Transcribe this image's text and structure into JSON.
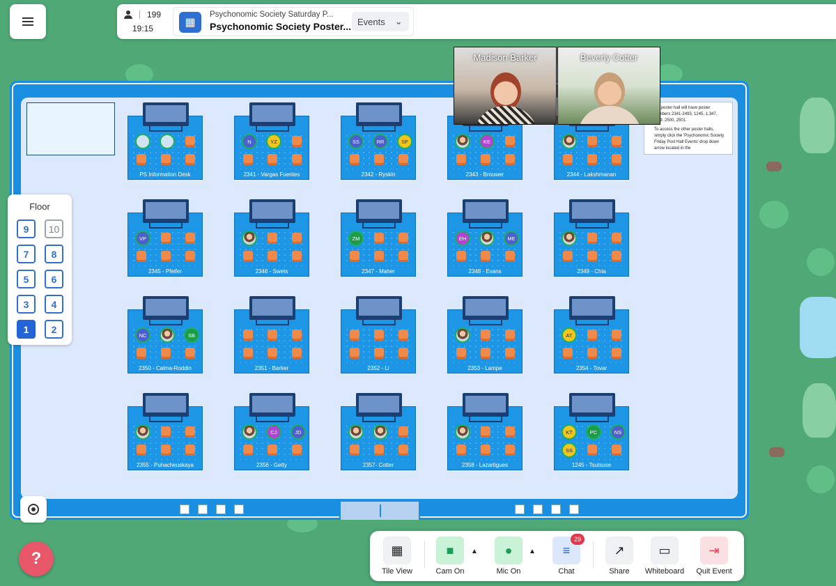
{
  "header": {
    "participants": "199",
    "time": "19:15",
    "event_subtitle": "Psychonomic Society Saturday P...",
    "event_title": "Psychonomic Society Poster...",
    "events_dropdown": "Events"
  },
  "floor_panel": {
    "title": "Floor",
    "floors": [
      "9",
      "10",
      "7",
      "8",
      "5",
      "6",
      "3",
      "4",
      "1",
      "2"
    ],
    "active": "1"
  },
  "videos": [
    {
      "name": "Madison Barker"
    },
    {
      "name": "Beverly Cotter"
    }
  ],
  "notes": {
    "line1": "...s poster hall will have poster numbers 2341-2493, 1245, 1,347, ...99, 2500, 2501.",
    "line2": "To access the other poster halls, simply click the 'Psychonomic Society Friday Post Hall Events' drop down arrow located in the"
  },
  "booths": [
    {
      "label": "PS Information Desk",
      "avatars": [
        {
          "t": "",
          "c": "#cfe3f2"
        },
        {
          "t": "",
          "c": "#cfe3f2"
        }
      ]
    },
    {
      "label": "2341 - Vargas Fuentes",
      "avatars": [
        {
          "t": "N",
          "c": "#4a5fd0"
        },
        {
          "t": "YZ",
          "c": "#f2c61f"
        }
      ]
    },
    {
      "label": "2342 - Ryskin",
      "avatars": [
        {
          "t": "SS",
          "c": "#4a5fd0"
        },
        {
          "t": "RR",
          "c": "#4a5fd0"
        },
        {
          "t": "SF",
          "c": "#f2c61f"
        }
      ]
    },
    {
      "label": "2343 - Brouwer",
      "avatars": [
        {
          "t": "",
          "c": "photo"
        },
        {
          "t": "KE",
          "c": "#b044d6"
        }
      ]
    },
    {
      "label": "2344 - Lakshmanan",
      "avatars": [
        {
          "t": "",
          "c": "photo"
        }
      ]
    },
    {
      "label": "2345 - Pfeifer",
      "avatars": [
        {
          "t": "VP",
          "c": "#4a5fd0"
        }
      ]
    },
    {
      "label": "2346 - Swets",
      "avatars": [
        {
          "t": "",
          "c": "photo"
        }
      ]
    },
    {
      "label": "2347 - Maher",
      "avatars": [
        {
          "t": "ZM",
          "c": "#1e9b4a"
        }
      ]
    },
    {
      "label": "2348 - Evans",
      "avatars": [
        {
          "t": "EH",
          "c": "#b044d6"
        },
        {
          "t": "",
          "c": "photo"
        },
        {
          "t": "ME",
          "c": "#4a5fd0"
        }
      ]
    },
    {
      "label": "2349 - Chia",
      "avatars": [
        {
          "t": "",
          "c": "photo"
        }
      ]
    },
    {
      "label": "2350 - Calma-Roddin",
      "avatars": [
        {
          "t": "NC",
          "c": "#4a5fd0"
        },
        {
          "t": "",
          "c": "photo"
        },
        {
          "t": "SB",
          "c": "#1e9b4a"
        }
      ]
    },
    {
      "label": "2351 - Barker",
      "avatars": []
    },
    {
      "label": "2352 - Li",
      "avatars": []
    },
    {
      "label": "2353 - Lampe",
      "avatars": [
        {
          "t": "",
          "c": "photo"
        }
      ]
    },
    {
      "label": "2354 - Tovar",
      "avatars": [
        {
          "t": "AT",
          "c": "#f2c61f"
        }
      ]
    },
    {
      "label": "2355 - Puhacheuskaya",
      "avatars": [
        {
          "t": "",
          "c": "photo"
        }
      ]
    },
    {
      "label": "2356 - Getty",
      "avatars": [
        {
          "t": "",
          "c": "photo"
        },
        {
          "t": "CJ",
          "c": "#b044d6"
        },
        {
          "t": "JD",
          "c": "#4a5fd0"
        }
      ]
    },
    {
      "label": "2357- Cotter",
      "avatars": [
        {
          "t": "",
          "c": "photo"
        },
        {
          "t": "",
          "c": "photo"
        }
      ]
    },
    {
      "label": "2358 - Lazartigues",
      "avatars": [
        {
          "t": "",
          "c": "photo"
        }
      ]
    },
    {
      "label": "1245 - Tsutsuse",
      "avatars": [
        {
          "t": "KT",
          "c": "#f2c61f"
        },
        {
          "t": "PC",
          "c": "#1e9b4a"
        },
        {
          "t": "NS",
          "c": "#4a5fd0"
        },
        {
          "t": "SS",
          "c": "#f2c61f"
        }
      ]
    }
  ],
  "toolbar": {
    "tile_view": "Tile View",
    "cam_on": "Cam On",
    "mic_on": "Mic On",
    "chat": "Chat",
    "chat_badge": "29",
    "share": "Share",
    "whiteboard": "Whiteboard",
    "quit_event": "Quit Event"
  },
  "icons": {
    "menu": "hamburger-icon",
    "participants": "person-icon",
    "event": "building-icon",
    "locate": "locate-icon",
    "help": "help-chat-icon"
  },
  "colors": {
    "grass": "#4fa876",
    "room_frame": "#1a8ee0",
    "floor": "#dce8fb",
    "accent": "#2464d6"
  }
}
